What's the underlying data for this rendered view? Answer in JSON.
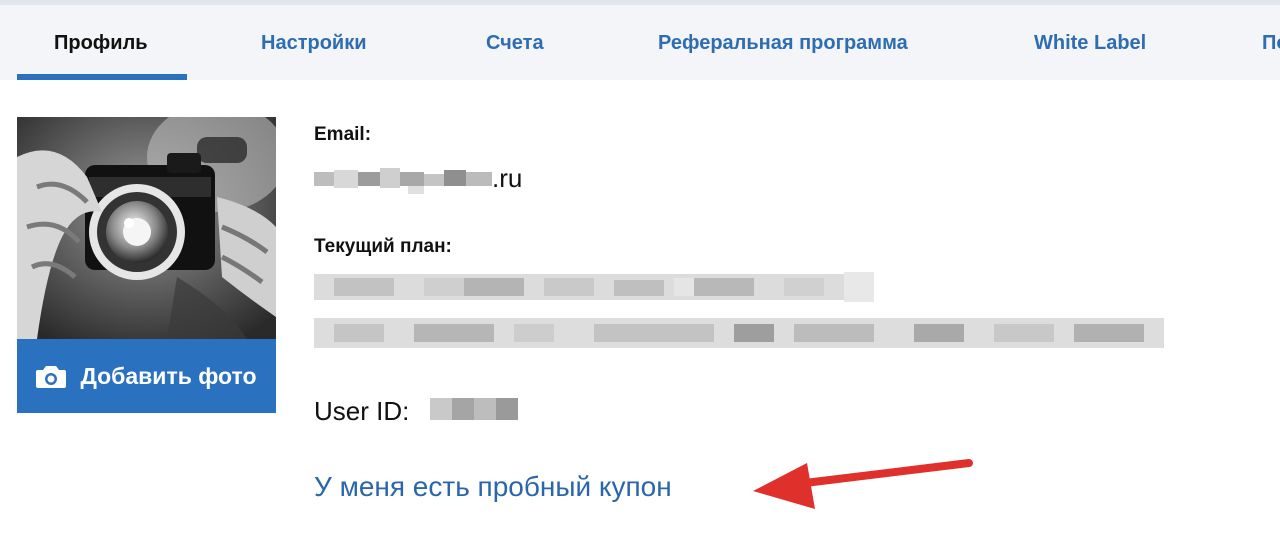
{
  "tabs": [
    {
      "label": "Профиль",
      "active": true
    },
    {
      "label": "Настройки"
    },
    {
      "label": "Счета"
    },
    {
      "label": "Реферальная программа"
    },
    {
      "label": "White Label"
    },
    {
      "label": "По"
    }
  ],
  "avatar": {
    "add_photo_label": "Добавить фото",
    "icon": "camera-icon"
  },
  "profile": {
    "email_label": "Email:",
    "email_visible_suffix": ".ru",
    "plan_label": "Текущий план:",
    "user_id_label": "User ID:",
    "coupon_link": "У меня есть пробный купон"
  },
  "colors": {
    "accent": "#2a72c0",
    "link": "#2a66ad",
    "tab_bg": "#f3f5f8",
    "arrow": "#e0302b"
  }
}
